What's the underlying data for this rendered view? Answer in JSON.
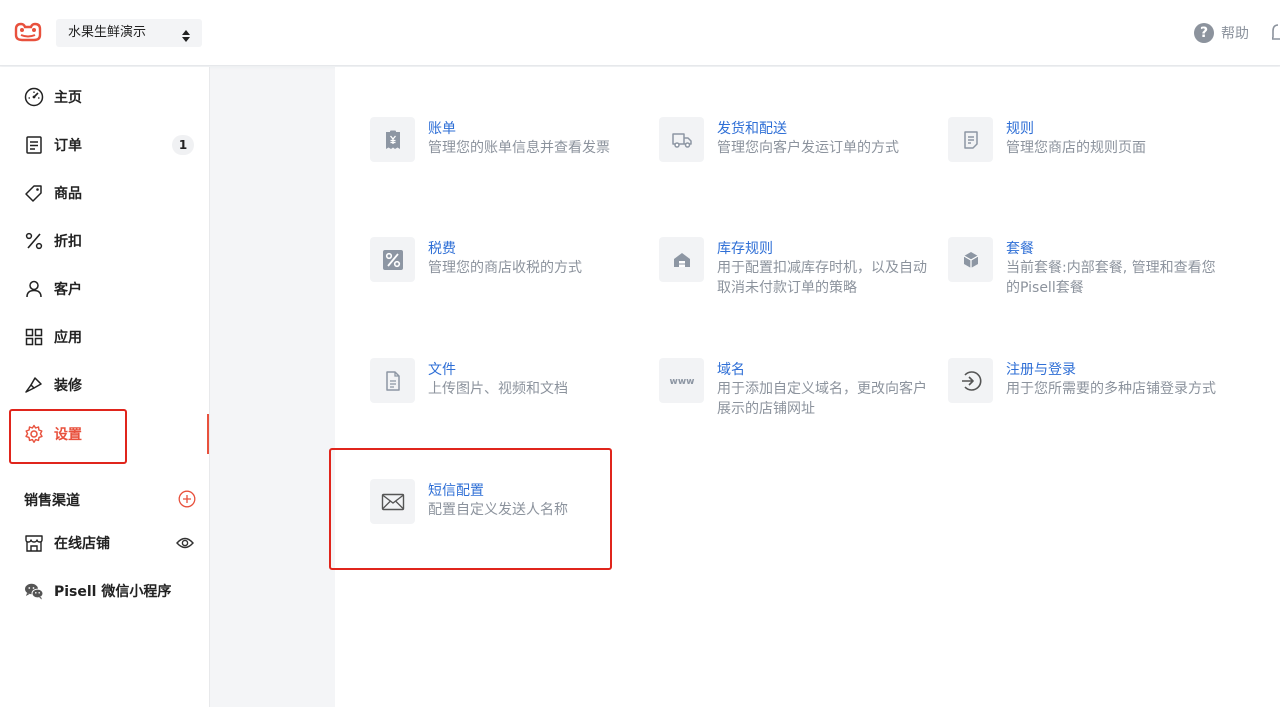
{
  "header": {
    "store_name": "水果生鲜演示",
    "help_label": "帮助"
  },
  "sidebar": {
    "items": [
      {
        "label": "主页",
        "icon": "dashboard-icon"
      },
      {
        "label": "订单",
        "icon": "order-icon",
        "badge": "1"
      },
      {
        "label": "商品",
        "icon": "tag-icon"
      },
      {
        "label": "折扣",
        "icon": "percent-icon"
      },
      {
        "label": "客户",
        "icon": "user-icon"
      },
      {
        "label": "应用",
        "icon": "apps-icon"
      },
      {
        "label": "装修",
        "icon": "brush-icon"
      },
      {
        "label": "设置",
        "icon": "gear-icon",
        "active": true
      }
    ],
    "channels_title": "销售渠道",
    "channels": [
      {
        "label": "在线店铺",
        "icon": "store-icon"
      },
      {
        "label": "Pisell 微信小程序",
        "icon": "wechat-icon"
      }
    ]
  },
  "settings": {
    "cards": [
      {
        "title": "账单",
        "desc": "管理您的账单信息并查看发票",
        "icon": "bill-icon"
      },
      {
        "title": "发货和配送",
        "desc": "管理您向客户发运订单的方式",
        "icon": "truck-icon"
      },
      {
        "title": "规则",
        "desc": "管理您商店的规则页面",
        "icon": "rules-icon"
      },
      {
        "title": "税费",
        "desc": "管理您的商店收税的方式",
        "icon": "percent-tile-icon"
      },
      {
        "title": "库存规则",
        "desc": "用于配置扣减库存时机，以及自动取消未付款订单的策略",
        "icon": "warehouse-icon"
      },
      {
        "title": "套餐",
        "desc": "当前套餐:内部套餐, 管理和查看您的Pisell套餐",
        "icon": "package-icon"
      },
      {
        "title": "文件",
        "desc": "上传图片、视频和文档",
        "icon": "file-icon"
      },
      {
        "title": "域名",
        "desc": "用于添加自定义域名，更改向客户展示的店铺网址",
        "icon": "domain-icon"
      },
      {
        "title": "注册与登录",
        "desc": "用于您所需要的多种店铺登录方式",
        "icon": "login-icon"
      },
      {
        "title": "短信配置",
        "desc": "配置自定义发送人名称",
        "icon": "mail-icon"
      }
    ]
  },
  "colors": {
    "accent": "#e8513d",
    "link": "#2f6fd6",
    "highlight": "#e0251c"
  }
}
